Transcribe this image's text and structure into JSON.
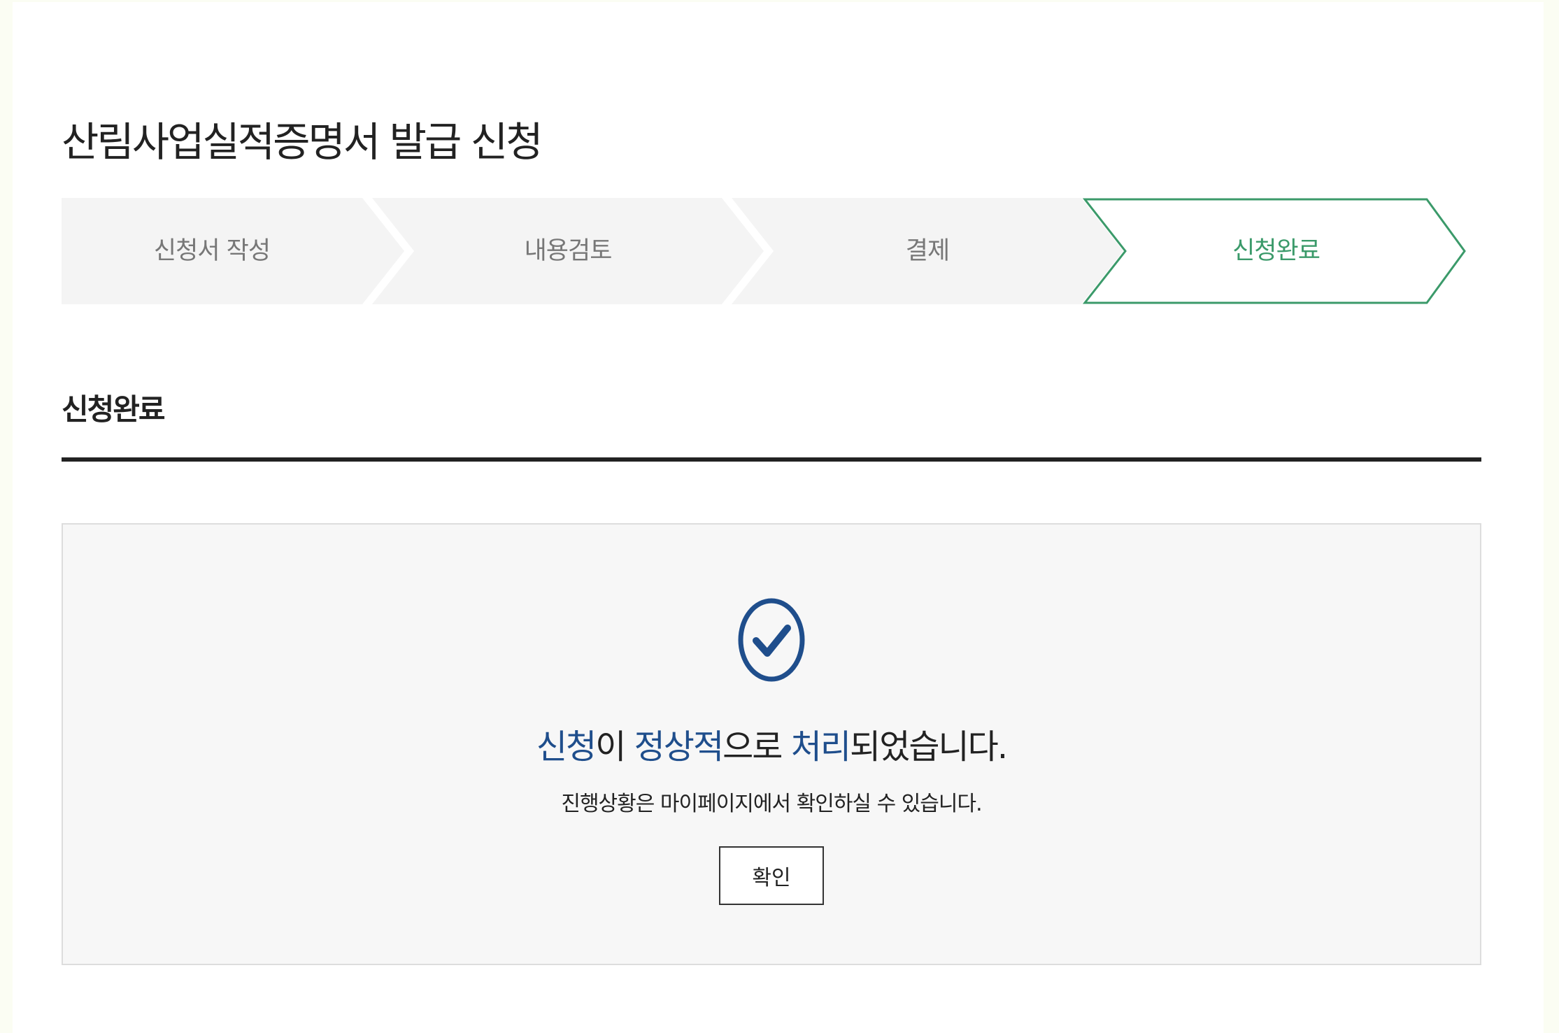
{
  "page": {
    "title": "산림사업실적증명서 발급 신청"
  },
  "steps": [
    {
      "label": "신청서 작성",
      "active": false
    },
    {
      "label": "내용검토",
      "active": false
    },
    {
      "label": "결제",
      "active": false
    },
    {
      "label": "신청완료",
      "active": true
    }
  ],
  "section": {
    "title": "신청완료"
  },
  "result": {
    "icon": "check-circle-icon",
    "message_parts": [
      {
        "text": "신청",
        "highlight": true
      },
      {
        "text": "이 ",
        "highlight": false
      },
      {
        "text": "정상적",
        "highlight": true
      },
      {
        "text": "으로 ",
        "highlight": false
      },
      {
        "text": "처리",
        "highlight": true
      },
      {
        "text": "되었습니다.",
        "highlight": false
      }
    ],
    "sub_message": "진행상황은 마이페이지에서 확인하실 수 있습니다.",
    "confirm_label": "확인"
  },
  "colors": {
    "accent_green": "#3b9a6a",
    "highlight_blue": "#1f4e8c",
    "step_inactive_bg": "#f4f4f4",
    "text_dark": "#222222"
  }
}
